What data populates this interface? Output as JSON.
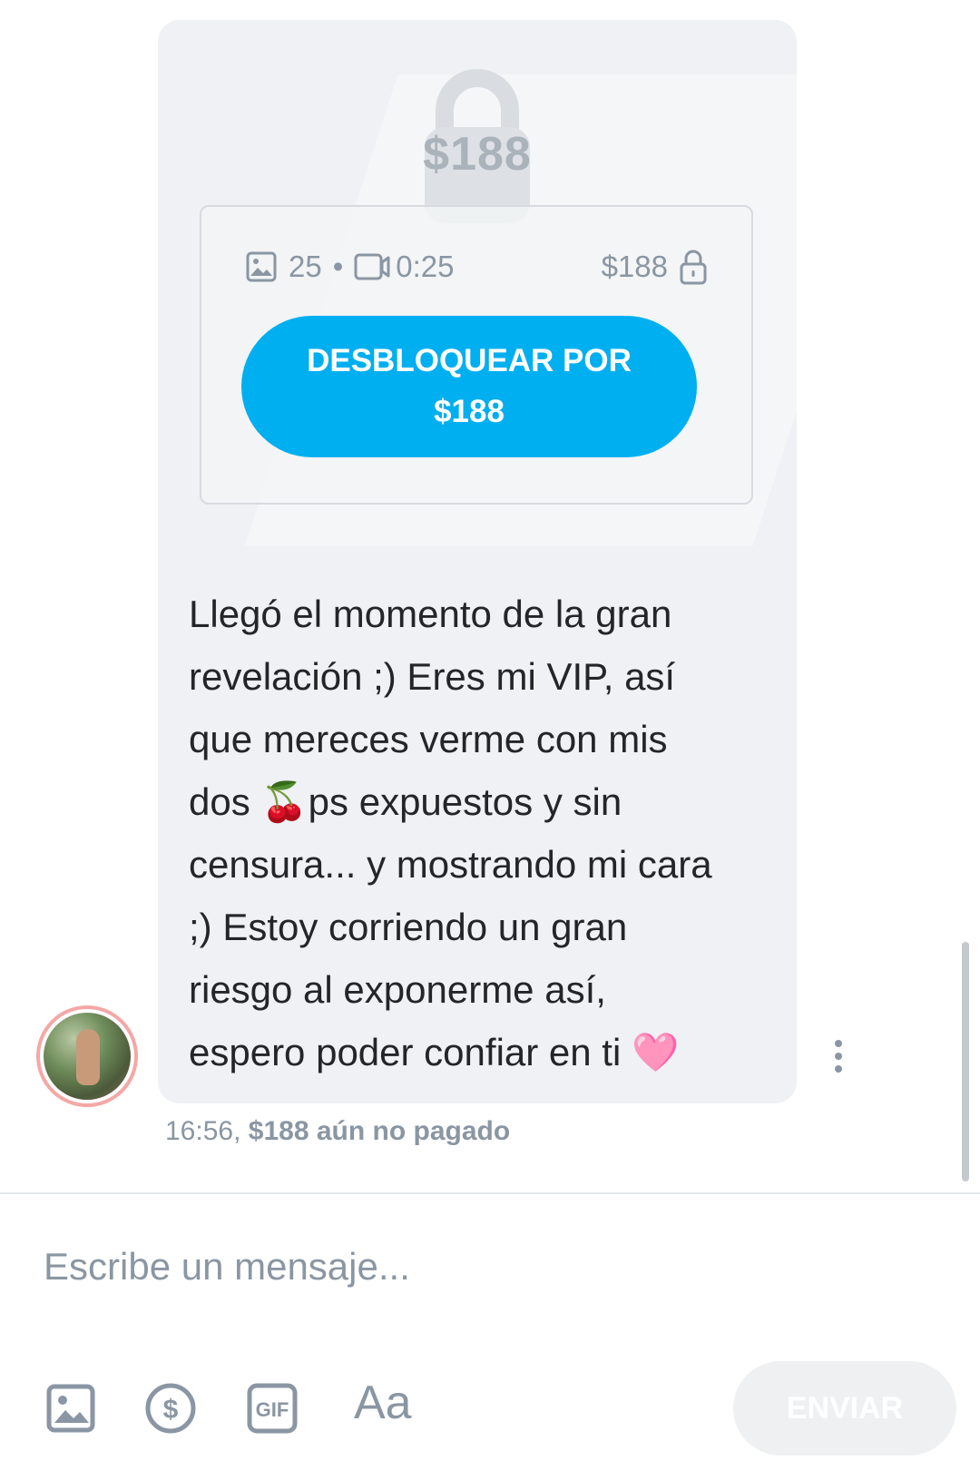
{
  "locked_media": {
    "big_price": "$188",
    "photo_count": "25",
    "separator": "•",
    "video_duration": "0:25",
    "price": "$188",
    "unlock_button": "DESBLOQUEAR POR\n$188"
  },
  "message": {
    "text": "Llegó el momento de la gran\nrevelación ;) Eres mi VIP, así\nque mereces verme con mis\ndos 🍒ps expuestos y sin\ncensura... y mostrando mi cara\n;) Estoy corriendo un gran\nriesgo al exponerme así,\nespero poder confiar en ti 🩷",
    "time": "16:56,",
    "status": "$188 aún no pagado"
  },
  "composer": {
    "placeholder": "Escribe un mensaje...",
    "font_label": "Aa",
    "send_label": "ENVIAR"
  },
  "colors": {
    "accent": "#00aff0",
    "bubble": "#eff1f4",
    "muted": "#8a96a3",
    "text": "#242529"
  }
}
